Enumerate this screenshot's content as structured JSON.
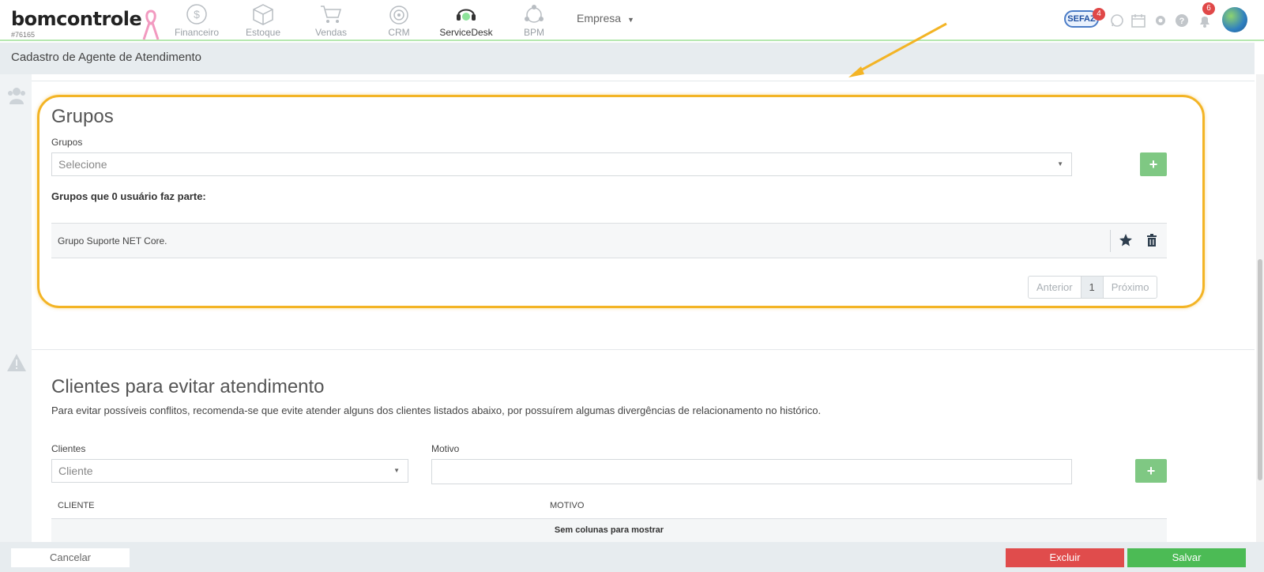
{
  "header": {
    "logo": "bomcontrole",
    "account_id": "#76165",
    "nav": [
      {
        "label": "Financeiro",
        "icon": "dollar-icon"
      },
      {
        "label": "Estoque",
        "icon": "box-icon"
      },
      {
        "label": "Vendas",
        "icon": "cart-icon"
      },
      {
        "label": "CRM",
        "icon": "target-icon"
      },
      {
        "label": "ServiceDesk",
        "icon": "headset-icon"
      },
      {
        "label": "BPM",
        "icon": "bpm-icon"
      }
    ],
    "company_menu": "Empresa",
    "sefaz_label": "SEFAZ",
    "sefaz_badge": "4",
    "notifications_badge": "6"
  },
  "page_title": "Cadastro de Agente de Atendimento",
  "groups": {
    "title": "Grupos",
    "field_label": "Grupos",
    "select_placeholder": "Selecione",
    "add_label": "+",
    "member_heading": "Grupos que 0 usuário faz parte:",
    "rows": [
      {
        "name": "Grupo Suporte NET Core."
      }
    ],
    "pager": {
      "prev": "Anterior",
      "page": "1",
      "next": "Próximo"
    }
  },
  "clients": {
    "title": "Clientes para evitar atendimento",
    "description": "Para evitar possíveis conflitos, recomenda-se que evite atender alguns dos clientes listados abaixo, por possuírem algumas divergências de relacionamento no histórico.",
    "client_label": "Clientes",
    "client_placeholder": "Cliente",
    "reason_label": "Motivo",
    "add_label": "+",
    "columns": [
      "CLIENTE",
      "MOTIVO"
    ],
    "empty_text": "Sem colunas para mostrar"
  },
  "footer": {
    "cancel": "Cancelar",
    "delete": "Excluir",
    "save": "Salvar"
  },
  "colors": {
    "accent_green": "#4cbb55",
    "danger_red": "#e04c4c",
    "highlight_yellow": "#f3b425"
  }
}
